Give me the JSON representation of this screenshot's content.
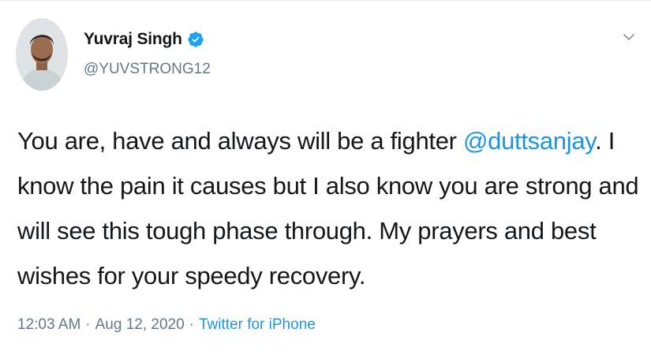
{
  "tweet": {
    "author": {
      "display_name": "Yuvraj Singh",
      "handle": "@YUVSTRONG12",
      "verified": true,
      "avatar_icon": "profile-photo"
    },
    "text": {
      "part1": "You are, have and always will be a fighter ",
      "mention": "@duttsanjay",
      "part2": ". I know the pain it causes but I also know you are strong and will see this tough phase through. My prayers and best wishes for your speedy recovery."
    },
    "meta": {
      "time": "12:03 AM",
      "separator": "·",
      "date": "Aug 12, 2020",
      "source": "Twitter for iPhone"
    },
    "menu_icon": "chevron-down-icon"
  },
  "colors": {
    "link": "#1b95e0",
    "verified": "#1da1f2",
    "secondary_text": "#657786",
    "primary_text": "#14171a"
  }
}
